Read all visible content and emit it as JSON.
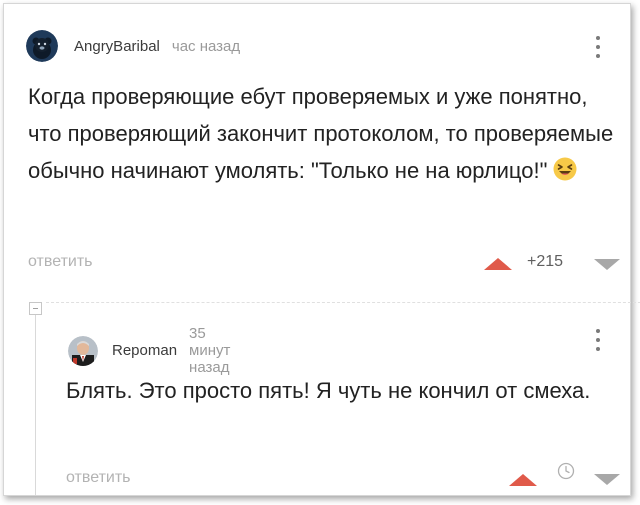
{
  "comments": [
    {
      "username": "AngryBaribal",
      "time": "час назад",
      "text": "Когда проверяющие ебут проверяемых и уже понятно, что проверяющий закончит протоколом, то проверяемые обычно начинают умолять: \"Только не на юрлицо!\"",
      "emoji": "laughing-emoji",
      "reply_label": "ответить",
      "rating": "+215"
    },
    {
      "username": "Repoman",
      "time": "35 минут назад",
      "text": "Блять. Это просто пять! Я чуть не кончил от смеха.",
      "reply_label": "ответить"
    }
  ],
  "colors": {
    "upvote": "#e05a4a",
    "downvote": "#a8a8a8",
    "reply_link": "#b3b3b3",
    "time": "#9a9a9a"
  }
}
